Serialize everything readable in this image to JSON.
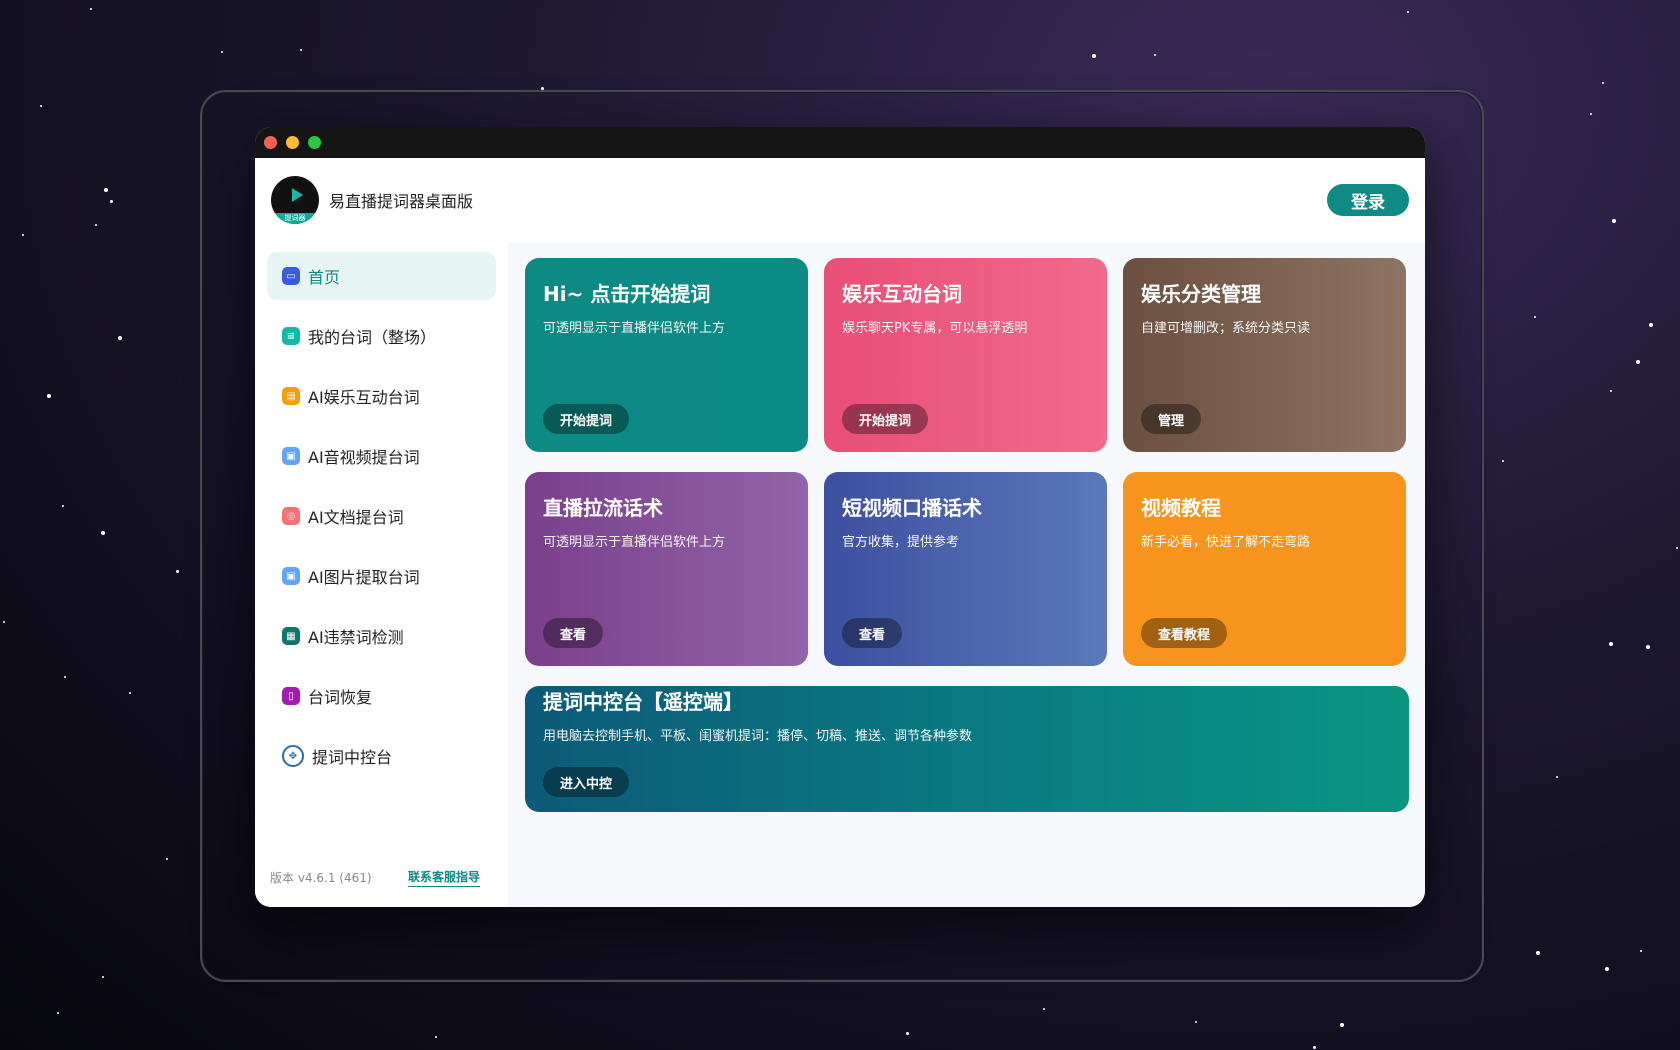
{
  "window": {
    "traffic_lights": [
      "#ff5f57",
      "#febc2e",
      "#28c840"
    ]
  },
  "header": {
    "logo_badge": "提词器",
    "app_title": "易直播提词器桌面版",
    "login_label": "登录"
  },
  "sidebar": {
    "items": [
      {
        "label": "首页",
        "icon": "home-icon",
        "color": "#3b5bdb"
      },
      {
        "label": "我的台词（整场）",
        "icon": "script-icon",
        "color": "#14b8a6"
      },
      {
        "label": "AI娱乐互动台词",
        "icon": "chat-icon",
        "color": "#f59e0b"
      },
      {
        "label": "AI音视频提台词",
        "icon": "media-icon",
        "color": "#60a5fa"
      },
      {
        "label": "AI文档提台词",
        "icon": "document-icon",
        "color": "#f87171"
      },
      {
        "label": "AI图片提取台词",
        "icon": "image-icon",
        "color": "#60a5fa"
      },
      {
        "label": "AI违禁词检测",
        "icon": "detect-icon",
        "color": "#0f766e"
      },
      {
        "label": "台词恢复",
        "icon": "restore-icon",
        "color": "#a21caf"
      },
      {
        "label": "提词中控台",
        "icon": "control-icon",
        "color": "#2b6cb0"
      }
    ],
    "version": "版本 v4.6.1 (461)",
    "support": "联系客服指导"
  },
  "cards": [
    {
      "title": "Hi~ 点击开始提词",
      "subtitle": "可透明显示于直播伴侣软件上方",
      "button": "开始提词",
      "gradient": [
        "#0e8a84",
        "#0c8a86"
      ]
    },
    {
      "title": "娱乐互动台词",
      "subtitle": "娱乐聊天PK专属，可以悬浮透明",
      "button": "开始提词",
      "gradient": [
        "#e94e77",
        "#f06a8c"
      ]
    },
    {
      "title": "娱乐分类管理",
      "subtitle": "自建可增删改；系统分类只读",
      "button": "管理",
      "gradient": [
        "#6b4f3f",
        "#8e7462"
      ]
    },
    {
      "title": "直播拉流话术",
      "subtitle": "可透明显示于直播伴侣软件上方",
      "button": "查看",
      "gradient": [
        "#7a3f8c",
        "#9264a8"
      ]
    },
    {
      "title": "短视频口播话术",
      "subtitle": "官方收集，提供参考",
      "button": "查看",
      "gradient": [
        "#3d4fa0",
        "#5b79bb"
      ]
    },
    {
      "title": "视频教程",
      "subtitle": "新手必看，快进了解不走弯路",
      "button": "查看教程",
      "gradient": [
        "#f7941d",
        "#f7941d"
      ]
    }
  ],
  "control_card": {
    "title": "提词中控台【遥控端】",
    "subtitle": "用电脑去控制手机、平板、闺蜜机提词：播停、切稿、推送、调节各种参数",
    "button": "进入中控"
  }
}
